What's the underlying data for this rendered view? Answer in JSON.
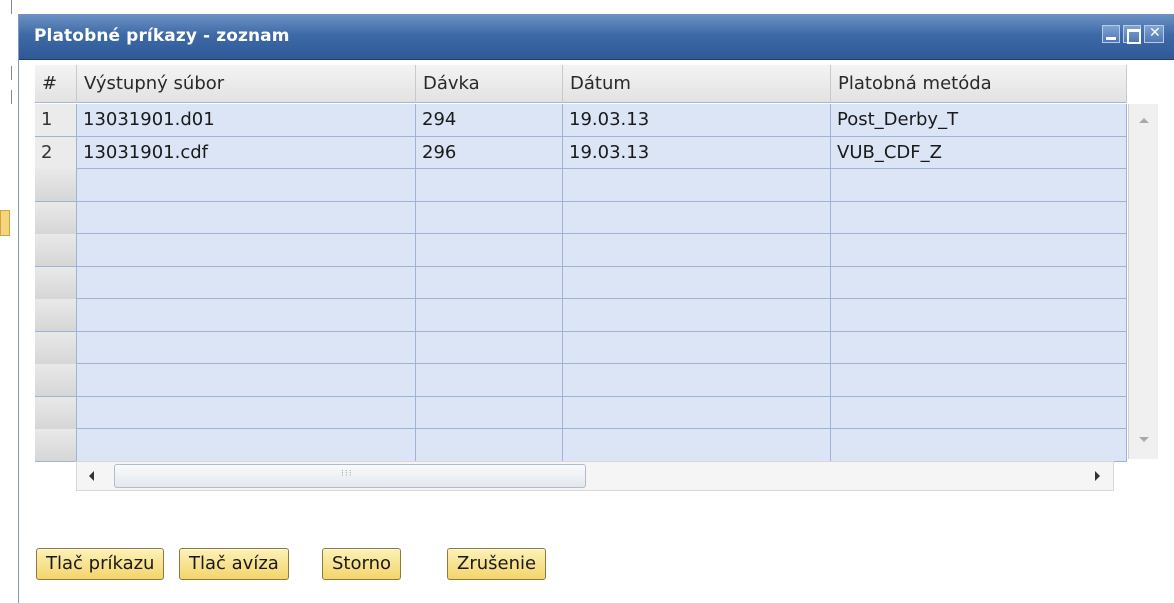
{
  "window": {
    "title": "Platobné príkazy - zoznam"
  },
  "grid": {
    "columns": [
      "#",
      "Výstupný súbor",
      "Dávka",
      "Dátum",
      "Platobná metóda"
    ],
    "rows": [
      {
        "num": "1",
        "file": "13031901.d01",
        "batch": "294",
        "date": "19.03.13",
        "method": "Post_Derby_T"
      },
      {
        "num": "2",
        "file": "13031901.cdf",
        "batch": "296",
        "date": "19.03.13",
        "method": "VUB_CDF_Z"
      }
    ],
    "empty_rows": 9
  },
  "buttons": {
    "print_order": "Tlač príkazu",
    "print_advice": "Tlač avíza",
    "storno": "Storno",
    "cancel": "Zrušenie"
  },
  "colors": {
    "titlebar": "#3f6aa8",
    "row_bg": "#dbe5f5",
    "button_bg": "#f3d56a"
  }
}
